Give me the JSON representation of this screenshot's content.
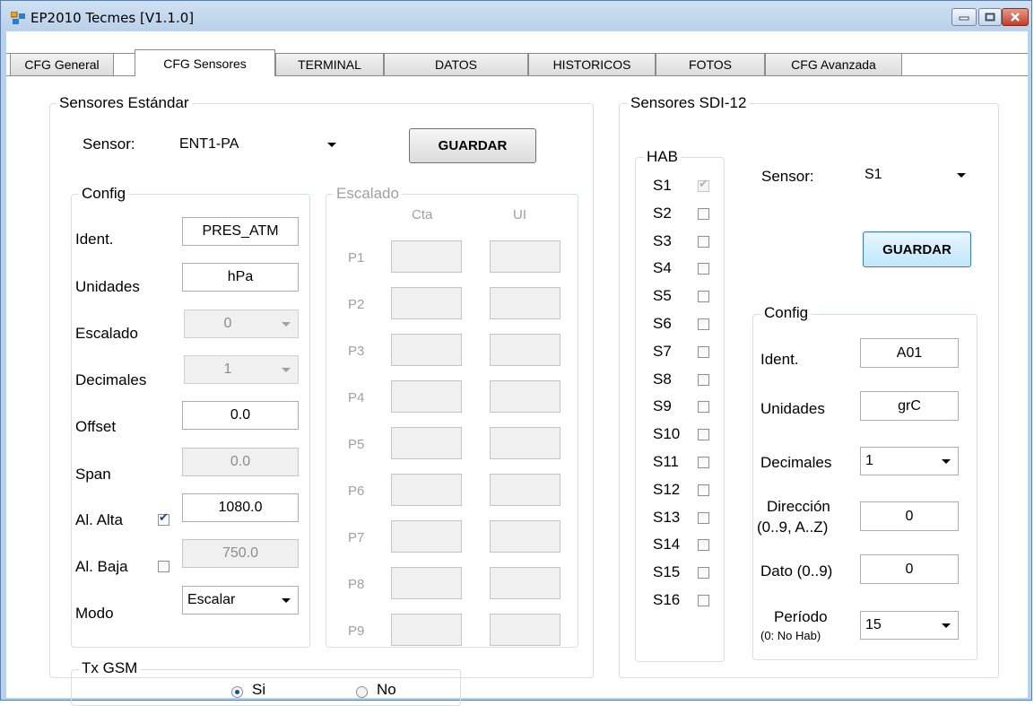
{
  "window": {
    "title": "EP2010 Tecmes  [V1.1.0]"
  },
  "tabs": [
    "CFG General",
    "CFG Sensores",
    "TERMINAL",
    "DATOS",
    "HISTORICOS",
    "FOTOS",
    "CFG Avanzada"
  ],
  "std": {
    "group_title": "Sensores Estándar",
    "sensor_label": "Sensor:",
    "sensor_value": "ENT1-PA",
    "save_button": "GUARDAR",
    "config": {
      "title": "Config",
      "ident_label": "Ident.",
      "ident_value": "PRES_ATM",
      "unidades_label": "Unidades",
      "unidades_value": "hPa",
      "escalado_label": "Escalado",
      "escalado_value": "0",
      "decimales_label": "Decimales",
      "decimales_value": "1",
      "offset_label": "Offset",
      "offset_value": "0.0",
      "span_label": "Span",
      "span_value": "0.0",
      "al_alta_label": "Al. Alta",
      "al_alta_checked": true,
      "al_alta_value": "1080.0",
      "al_baja_label": "Al. Baja",
      "al_baja_checked": false,
      "al_baja_value": "750.0",
      "modo_label": "Modo",
      "modo_value": "Escalar"
    },
    "scaling": {
      "title": "Escalado",
      "col_cta": "Cta",
      "col_ui": "UI",
      "points": [
        "P1",
        "P2",
        "P3",
        "P4",
        "P5",
        "P6",
        "P7",
        "P8",
        "P9"
      ]
    },
    "txgsm": {
      "title": "Tx GSM",
      "yes": "Si",
      "no": "No",
      "selected": "Si"
    }
  },
  "sdi": {
    "group_title": "Sensores SDI-12",
    "hab_title": "HAB",
    "hab": [
      "S1",
      "S2",
      "S3",
      "S4",
      "S5",
      "S6",
      "S7",
      "S8",
      "S9",
      "S10",
      "S11",
      "S12",
      "S13",
      "S14",
      "S15",
      "S16"
    ],
    "sensor_label": "Sensor:",
    "sensor_value": "S1",
    "save_button": "GUARDAR",
    "config": {
      "title": "Config",
      "ident_label": "Ident.",
      "ident_value": "A01",
      "unidades_label": "Unidades",
      "unidades_value": "grC",
      "decimales_label": "Decimales",
      "decimales_value": "1",
      "direccion_label": "Dirección",
      "direccion_sub": "(0..9, A..Z)",
      "direccion_value": "0",
      "dato_label": "Dato (0..9)",
      "dato_value": "0",
      "periodo_label": "Período",
      "periodo_sub": "(0: No Hab)",
      "periodo_value": "15"
    }
  }
}
